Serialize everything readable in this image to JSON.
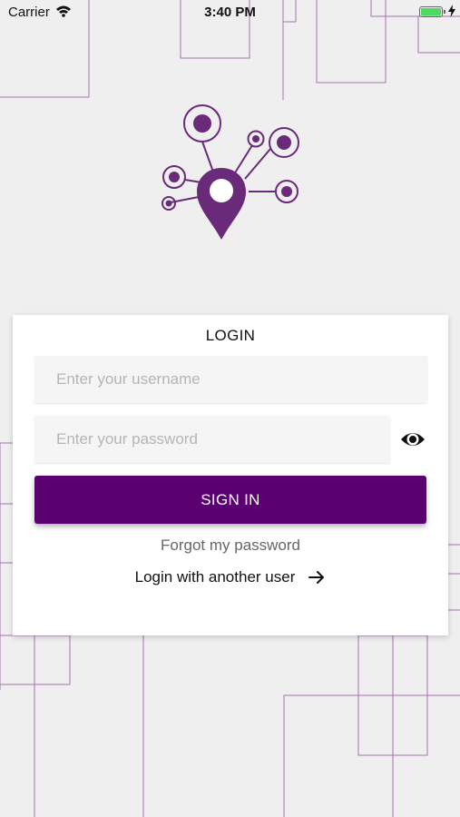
{
  "status_bar": {
    "carrier": "Carrier",
    "time": "3:40 PM",
    "battery_level": 1.0
  },
  "logo": {
    "icon": "network-location-pin-icon",
    "color": "#6a2a7a"
  },
  "login": {
    "title": "LOGIN",
    "username_placeholder": "Enter your username",
    "password_placeholder": "Enter your password",
    "password_toggle_icon": "eye-icon",
    "sign_in_label": "SIGN IN",
    "forgot_password_label": "Forgot my password",
    "another_user_label": "Login with another user",
    "another_user_icon": "arrow-right-icon"
  },
  "colors": {
    "background": "#efeff0",
    "card": "#ffffff",
    "primary": "#5a0070",
    "decorative_lines": "#8a4a98"
  }
}
